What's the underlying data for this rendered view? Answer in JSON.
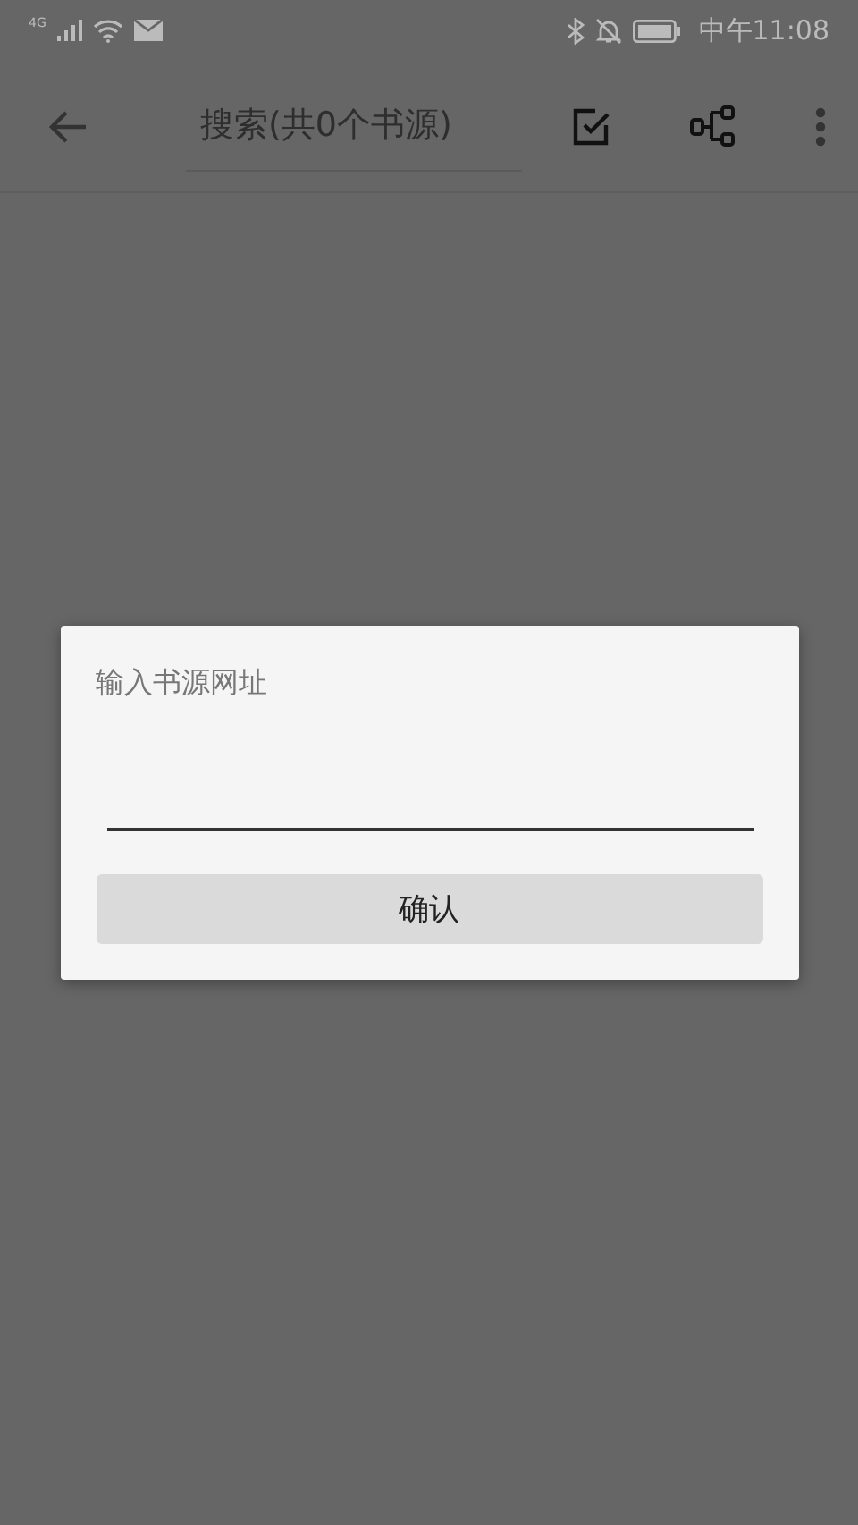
{
  "status_bar": {
    "network": "4G",
    "time": "中午11:08"
  },
  "toolbar": {
    "search": {
      "placeholder": "搜索(共0个书源)"
    }
  },
  "dialog": {
    "title": "输入书源网址",
    "confirm_button": "确认"
  }
}
